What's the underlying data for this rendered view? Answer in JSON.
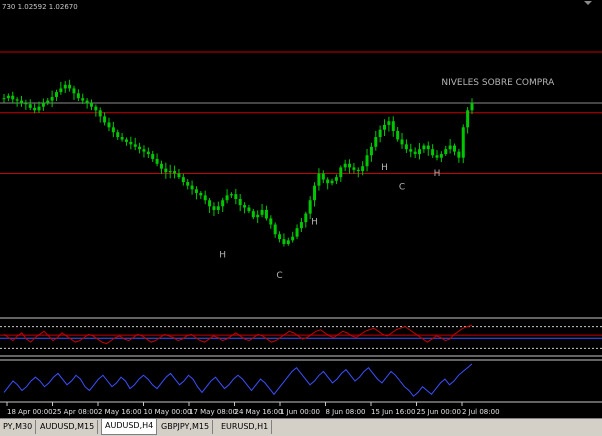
{
  "header": {
    "price_readout": "730 1.02592 1.02670"
  },
  "tabs": [
    {
      "label": "PY,M30",
      "active": false
    },
    {
      "label": "AUDUSD,M15",
      "active": false
    },
    {
      "label": "AUDUSD,H4",
      "active": true
    },
    {
      "label": "GBPJPY,M15",
      "active": false
    },
    {
      "label": "EURUSD,H1",
      "active": false
    }
  ],
  "colors": {
    "background": "#000000",
    "candles": "#00c800",
    "levels": "#c80000",
    "grey_level": "#8a8a8a",
    "annotation": "#b4b4b4",
    "oscillator": "#3c50ff"
  },
  "chart_data": [
    {
      "type": "line",
      "panel": "price",
      "title": "",
      "xlabel": "",
      "ylabel": "",
      "x_tick_labels": [
        "18 Apr 00:00",
        "25 Apr 08:00",
        "2 May 16:00",
        "10 May 00:00",
        "17 May 08:00",
        "24 May 16:00",
        "1 Jun 00:00",
        "8 Jun 08:00",
        "15 Jun 16:00",
        "25 Jun 00:00",
        "2 Jul 08:00"
      ],
      "series": [
        {
          "values": [
            0.62,
            0.64,
            0.61,
            0.6,
            0.58,
            0.57,
            0.54,
            0.52,
            0.55,
            0.58,
            0.6,
            0.63,
            0.67,
            0.7,
            0.73,
            0.7,
            0.66,
            0.62,
            0.6,
            0.58,
            0.55,
            0.52,
            0.47,
            0.42,
            0.38,
            0.34,
            0.3,
            0.28,
            0.26,
            0.24,
            0.22,
            0.2,
            0.18,
            0.16,
            0.12,
            0.08,
            0.04,
            0.01,
            0.02,
            0.0,
            -0.03,
            -0.07,
            -0.1,
            -0.13,
            -0.16,
            -0.18,
            -0.22,
            -0.27,
            -0.3,
            -0.27,
            -0.22,
            -0.18,
            -0.17,
            -0.21,
            -0.26,
            -0.28,
            -0.31,
            -0.36,
            -0.34,
            -0.3,
            -0.37,
            -0.42,
            -0.5,
            -0.54,
            -0.58,
            -0.55,
            -0.52,
            -0.45,
            -0.4,
            -0.33,
            -0.22,
            -0.1,
            0.0,
            -0.05,
            -0.08,
            -0.06,
            -0.03,
            0.05,
            0.08,
            0.05,
            0.03,
            0.02,
            0.06,
            0.15,
            0.22,
            0.3,
            0.36,
            0.4,
            0.43,
            0.35,
            0.28,
            0.24,
            0.2,
            0.18,
            0.16,
            0.2,
            0.23,
            0.2,
            0.15,
            0.13,
            0.16,
            0.2,
            0.23,
            0.18,
            0.13,
            0.38,
            0.52,
            0.58
          ]
        }
      ],
      "horizontal_levels": [
        {
          "value": 1.0,
          "color": "#c80000"
        },
        {
          "value": 0.58,
          "color": "#8a8a8a"
        },
        {
          "value": 0.5,
          "color": "#c80000"
        },
        {
          "value": 0.0,
          "color": "#c80000"
        }
      ],
      "annotations": [
        {
          "text": "NIVELES SOBRE COMPRA",
          "x_index": 100,
          "y": 0.73
        },
        {
          "text": "H",
          "x_index": 50,
          "y": -0.69
        },
        {
          "text": "C",
          "x_index": 63,
          "y": -0.86
        },
        {
          "text": "H",
          "x_index": 71,
          "y": -0.42
        },
        {
          "text": "H",
          "x_index": 87,
          "y": 0.03
        },
        {
          "text": "C",
          "x_index": 91,
          "y": -0.13
        },
        {
          "text": "H",
          "x_index": 99,
          "y": -0.02
        }
      ],
      "ylim": [
        -1,
        1
      ]
    },
    {
      "type": "line",
      "panel": "oscillator_1",
      "title": "",
      "series": [
        {
          "values": [
            0.2,
            0.0,
            -0.2,
            0.1,
            0.3,
            -0.1,
            -0.3,
            0.0,
            0.2,
            0.4,
            0.1,
            -0.2,
            0.0,
            0.3,
            0.1,
            -0.1,
            -0.3,
            -0.2,
            0.0,
            0.2,
            0.1,
            -0.1,
            -0.3,
            -0.4,
            -0.2,
            0.0,
            0.1,
            -0.1,
            -0.2,
            0.0,
            0.2,
            0.1,
            -0.1,
            -0.3,
            -0.2,
            0.0,
            0.2,
            0.1,
            0.0,
            -0.2,
            -0.1,
            0.1,
            0.2,
            0.0,
            -0.2,
            -0.3,
            -0.1,
            0.1,
            0.0,
            -0.2,
            -0.1,
            0.1,
            0.3,
            0.1,
            -0.1,
            -0.2,
            0.0,
            0.2,
            0.1,
            -0.1,
            -0.3,
            -0.2,
            0.0,
            0.2,
            0.4,
            0.3,
            0.1,
            -0.1,
            0.0,
            0.2,
            0.4,
            0.5,
            0.3,
            0.1,
            0.0,
            0.2,
            0.4,
            0.3,
            0.1,
            0.0,
            0.2,
            0.4,
            0.5,
            0.6,
            0.4,
            0.2,
            0.1,
            0.3,
            0.5,
            0.6,
            0.7,
            0.5,
            0.3,
            0.1,
            -0.1,
            -0.3,
            -0.1,
            0.1,
            0.0,
            -0.2,
            -0.1,
            0.2,
            0.4,
            0.6,
            0.7,
            0.8
          ]
        }
      ],
      "dashed_levels": [
        0.7,
        -0.7
      ],
      "ylim": [
        -1,
        1
      ]
    },
    {
      "type": "line",
      "panel": "oscillator_2",
      "title": "",
      "series": [
        {
          "values": [
            -0.6,
            -0.3,
            0.0,
            -0.2,
            -0.5,
            -0.3,
            0.0,
            0.2,
            0.0,
            -0.3,
            -0.1,
            0.2,
            0.4,
            0.1,
            -0.2,
            0.0,
            0.3,
            0.1,
            -0.3,
            -0.5,
            -0.2,
            0.1,
            0.3,
            0.0,
            -0.3,
            -0.1,
            0.2,
            0.0,
            -0.4,
            -0.2,
            0.1,
            0.3,
            0.1,
            -0.2,
            -0.4,
            -0.1,
            0.2,
            0.4,
            0.1,
            -0.2,
            0.0,
            0.3,
            0.1,
            -0.3,
            -0.6,
            -0.3,
            0.0,
            0.2,
            -0.1,
            -0.4,
            -0.2,
            0.1,
            0.3,
            0.1,
            -0.2,
            -0.5,
            -0.2,
            0.1,
            -0.1,
            -0.4,
            -0.7,
            -0.4,
            -0.1,
            0.2,
            0.5,
            0.7,
            0.4,
            0.1,
            -0.2,
            0.0,
            0.3,
            0.5,
            0.2,
            -0.1,
            0.1,
            0.4,
            0.6,
            0.3,
            0.0,
            0.2,
            0.5,
            0.7,
            0.4,
            0.1,
            -0.1,
            0.2,
            0.5,
            0.3,
            0.0,
            -0.3,
            -0.5,
            -0.8,
            -0.6,
            -0.3,
            -0.5,
            -0.7,
            -0.4,
            -0.1,
            0.1,
            -0.2,
            0.0,
            0.3,
            0.5,
            0.7,
            0.9
          ]
        }
      ],
      "ylim": [
        -1,
        1
      ]
    }
  ]
}
